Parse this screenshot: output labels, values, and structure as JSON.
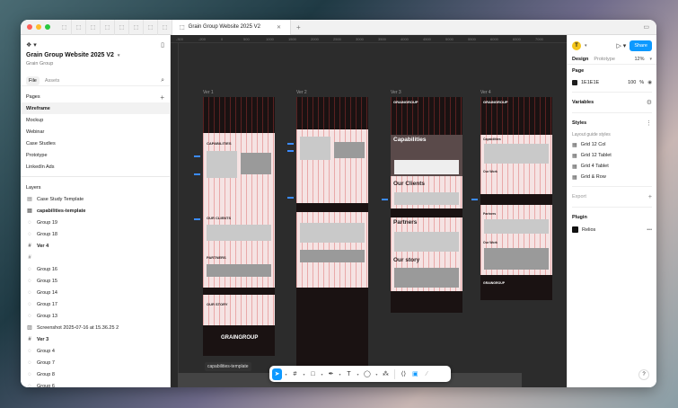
{
  "window": {
    "active_tab": "Grain Group Website 2025 V2",
    "tab_icon_count": 8
  },
  "left": {
    "project_title": "Grain Group Website 2025 V2",
    "project_sub": "Grain Group",
    "tabs": [
      {
        "label": "File",
        "active": true
      },
      {
        "label": "Assets",
        "active": false
      }
    ],
    "pages_label": "Pages",
    "pages": [
      {
        "label": "Wireframe",
        "selected": true
      },
      {
        "label": "Mockup",
        "selected": false
      },
      {
        "label": "Webinar",
        "selected": false
      },
      {
        "label": "Case Studies",
        "selected": false
      },
      {
        "label": "Prototype",
        "selected": false
      },
      {
        "label": "LinkedIn Ads",
        "selected": false
      }
    ],
    "layers_label": "Layers",
    "layers": [
      {
        "label": "Case Study Template",
        "icon": "component",
        "bold": false
      },
      {
        "label": "capabilities-template",
        "icon": "component",
        "bold": true
      },
      {
        "label": "Group 19",
        "icon": "group",
        "bold": false
      },
      {
        "label": "Group 18",
        "icon": "group",
        "bold": false
      },
      {
        "label": "Ver 4",
        "icon": "frame",
        "bold": true
      },
      {
        "label": "",
        "icon": "frame",
        "bold": false
      },
      {
        "label": "Group 16",
        "icon": "group",
        "bold": false
      },
      {
        "label": "Group 15",
        "icon": "group",
        "bold": false
      },
      {
        "label": "Group 14",
        "icon": "group",
        "bold": false
      },
      {
        "label": "Group 17",
        "icon": "group",
        "bold": false
      },
      {
        "label": "Group 13",
        "icon": "group",
        "bold": false
      },
      {
        "label": "Screenshot 2025-07-16 at 15.36.25 2",
        "icon": "image",
        "bold": false
      },
      {
        "label": "Ver 3",
        "icon": "frame",
        "bold": true
      },
      {
        "label": "Group 4",
        "icon": "group",
        "bold": false
      },
      {
        "label": "Group 7",
        "icon": "group",
        "bold": false
      },
      {
        "label": "Group 8",
        "icon": "group",
        "bold": false
      },
      {
        "label": "Group 6",
        "icon": "group",
        "bold": false
      }
    ]
  },
  "canvas": {
    "ruler_ticks": [
      "-300",
      "-200",
      "0",
      "500",
      "1000",
      "1500",
      "2000",
      "2500",
      "3000",
      "3500",
      "4000",
      "4500",
      "5000",
      "5500",
      "6000",
      "6500",
      "7000"
    ],
    "frames": [
      {
        "label": "Ver 1",
        "texts": [
          "CAPABILITIES",
          "OUR CLIENTS",
          "PARTNERS",
          "OUR STORY",
          "GRAINGROUP"
        ]
      },
      {
        "label": "Ver 2",
        "texts": []
      },
      {
        "label": "Ver 3",
        "texts": [
          "GRAINGROUP",
          "Capabilities",
          "Our Clients",
          "Partners",
          "Our story"
        ]
      },
      {
        "label": "Ver 4",
        "texts": [
          "GRAINGROUP",
          "Capabilities",
          "Our Work",
          "Partners",
          "Our Work",
          "GRAINGROUP"
        ]
      }
    ],
    "selection_label": "capabilities-template"
  },
  "toolbar": {
    "tools": [
      "move",
      "frame",
      "shape",
      "pen",
      "text",
      "comment",
      "actions",
      "dev-mode",
      "code"
    ]
  },
  "right": {
    "avatar_initial": "T",
    "share_label": "Share",
    "tabs": [
      {
        "label": "Design",
        "active": true
      },
      {
        "label": "Prototype",
        "active": false
      }
    ],
    "zoom": "12%",
    "page_label": "Page",
    "page_fill": {
      "hex": "1E1E1E",
      "opacity": "100",
      "unit": "%",
      "swatch": "#1e1e1e"
    },
    "variables_label": "Variables",
    "styles_label": "Styles",
    "layout_guide_label": "Layout guide styles",
    "grid_styles": [
      "Grid 12 Col",
      "Grid 12 Tablet",
      "Grid 4 Tablet",
      "Grid & Row"
    ],
    "export_label": "Export",
    "plugin_label": "Plugin",
    "plugin_name": "Relios",
    "help": "?"
  },
  "colors": {
    "accent": "#0d99ff",
    "canvas_bg": "#2c2c2c",
    "frame_bg": "#f5e3e3",
    "frame_dark": "#1a1212"
  }
}
